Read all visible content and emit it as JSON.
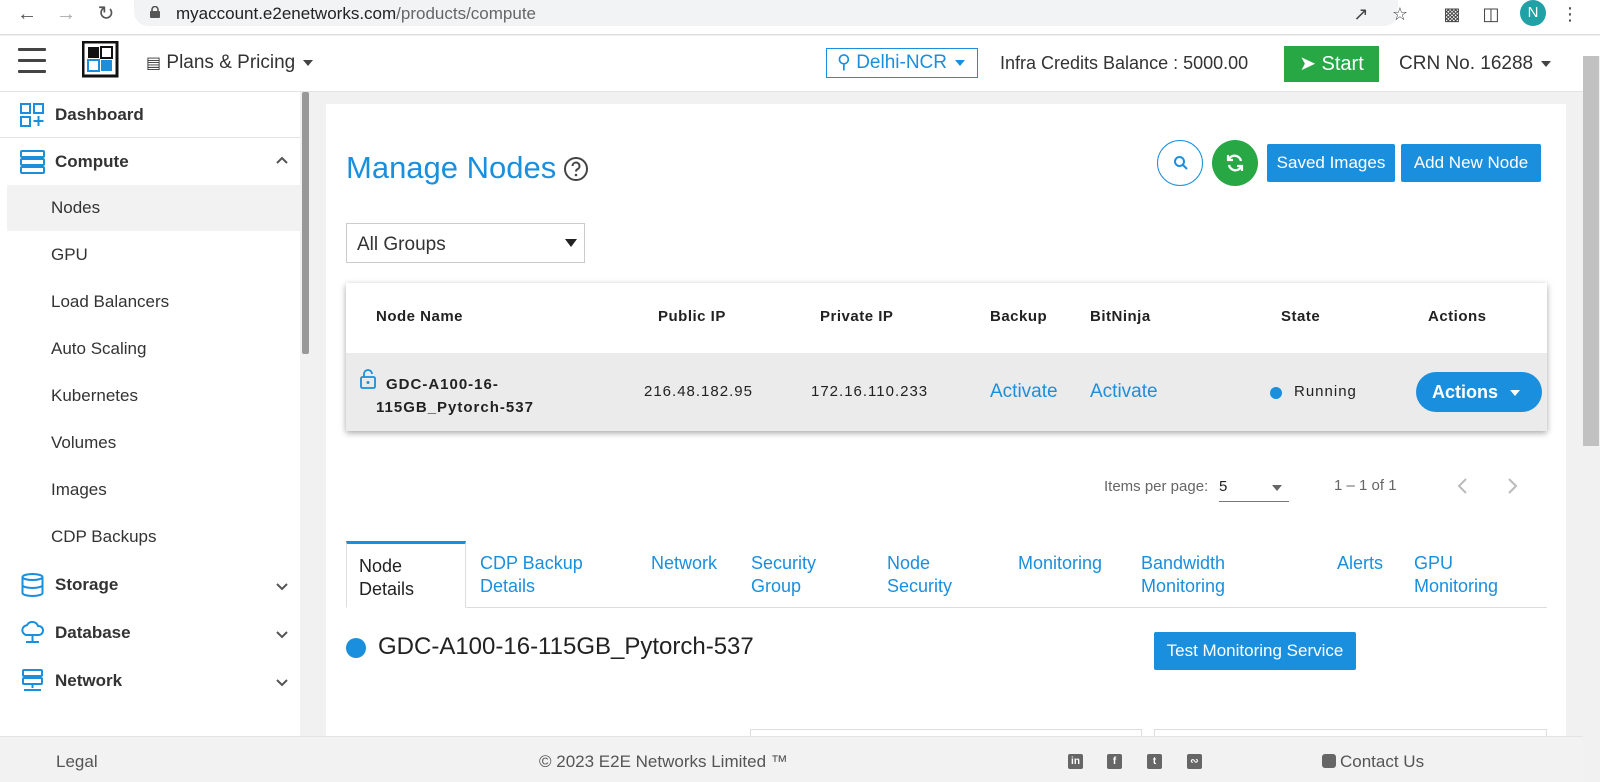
{
  "browser": {
    "url_host": "myaccount.e2enetworks.com",
    "url_path": "/products/compute",
    "profile_initial": "N"
  },
  "header": {
    "plans_label": "Plans & Pricing",
    "region": "Delhi-NCR",
    "credits": "Infra Credits Balance : 5000.00",
    "start_label": "Start",
    "crn": "CRN No. 16288"
  },
  "sidebar": {
    "dashboard": "Dashboard",
    "compute": "Compute",
    "compute_items": [
      "Nodes",
      "GPU",
      "Load Balancers",
      "Auto Scaling",
      "Kubernetes",
      "Volumes",
      "Images",
      "CDP Backups"
    ],
    "storage": "Storage",
    "database": "Database",
    "network": "Network"
  },
  "main": {
    "title": "Manage Nodes",
    "saved_images": "Saved Images",
    "add_node": "Add New Node",
    "group_filter": "All Groups"
  },
  "table": {
    "headers": [
      "Node Name",
      "Public IP",
      "Private IP",
      "Backup",
      "BitNinja",
      "State",
      "Actions"
    ],
    "row": {
      "name_line1": "GDC-A100-16-",
      "name_line2": "115GB_Pytorch-537",
      "public_ip": "216.48.182.95",
      "private_ip": "172.16.110.233",
      "backup": "Activate",
      "bitninja": "Activate",
      "state": "Running",
      "actions": "Actions"
    }
  },
  "pagination": {
    "label": "Items per page:",
    "per_page": "5",
    "range": "1 – 1 of 1"
  },
  "tabs": [
    {
      "line1": "Node",
      "line2": "Details"
    },
    {
      "line1": "CDP Backup",
      "line2": "Details"
    },
    {
      "line1": "Network",
      "line2": ""
    },
    {
      "line1": "Security",
      "line2": "Group"
    },
    {
      "line1": "Node",
      "line2": "Security"
    },
    {
      "line1": "Monitoring",
      "line2": ""
    },
    {
      "line1": "Bandwidth",
      "line2": "Monitoring"
    },
    {
      "line1": "Alerts",
      "line2": ""
    },
    {
      "line1": "GPU",
      "line2": "Monitoring"
    }
  ],
  "detail": {
    "node_title": "GDC-A100-16-115GB_Pytorch-537",
    "test_button": "Test Monitoring Service"
  },
  "footer": {
    "legal": "Legal",
    "copyright": "© 2023 E2E Networks Limited ™",
    "contact": "Contact Us",
    "social_icons": [
      "linkedin-icon",
      "facebook-icon",
      "twitter-icon",
      "rss-icon"
    ]
  },
  "colors": {
    "accent": "#1a8fdd",
    "success": "#28a745"
  }
}
